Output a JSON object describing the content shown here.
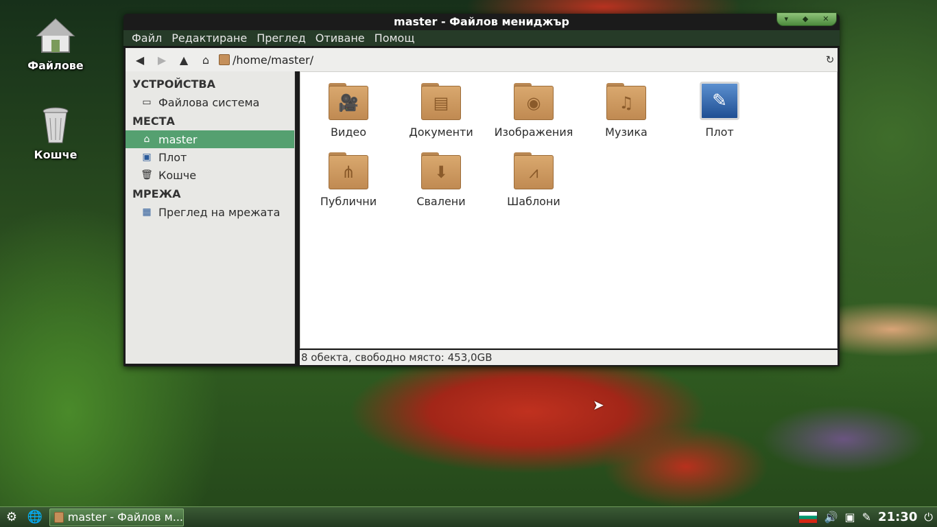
{
  "desktop": {
    "icons": [
      {
        "label": "Файлове"
      },
      {
        "label": "Кошче"
      }
    ]
  },
  "window": {
    "title": "master - Файлов мениджър",
    "menu": [
      "Файл",
      "Редактиране",
      "Преглед",
      "Отиване",
      "Помощ"
    ],
    "path": "/home/master/",
    "sidebar": {
      "devices_heading": "УСТРОЙСТВА",
      "devices": [
        {
          "label": "Файлова система"
        }
      ],
      "places_heading": "МЕСТА",
      "places": [
        {
          "label": "master"
        },
        {
          "label": "Плот"
        },
        {
          "label": "Кошче"
        }
      ],
      "network_heading": "МРЕЖА",
      "network": [
        {
          "label": "Преглед на мрежата"
        }
      ]
    },
    "files": [
      {
        "label": "Видео",
        "icon": "video-folder-icon"
      },
      {
        "label": "Документи",
        "icon": "documents-folder-icon"
      },
      {
        "label": "Изображения",
        "icon": "pictures-folder-icon"
      },
      {
        "label": "Музика",
        "icon": "music-folder-icon"
      },
      {
        "label": "Плот",
        "icon": "desktop-icon"
      },
      {
        "label": "Публични",
        "icon": "public-folder-icon"
      },
      {
        "label": "Свалени",
        "icon": "downloads-folder-icon"
      },
      {
        "label": "Шаблони",
        "icon": "templates-folder-icon"
      }
    ],
    "status": "8 обекта, свободно място: 453,0GB"
  },
  "taskbar": {
    "task_label": "master - Файлов м...",
    "clock": "21:30"
  }
}
